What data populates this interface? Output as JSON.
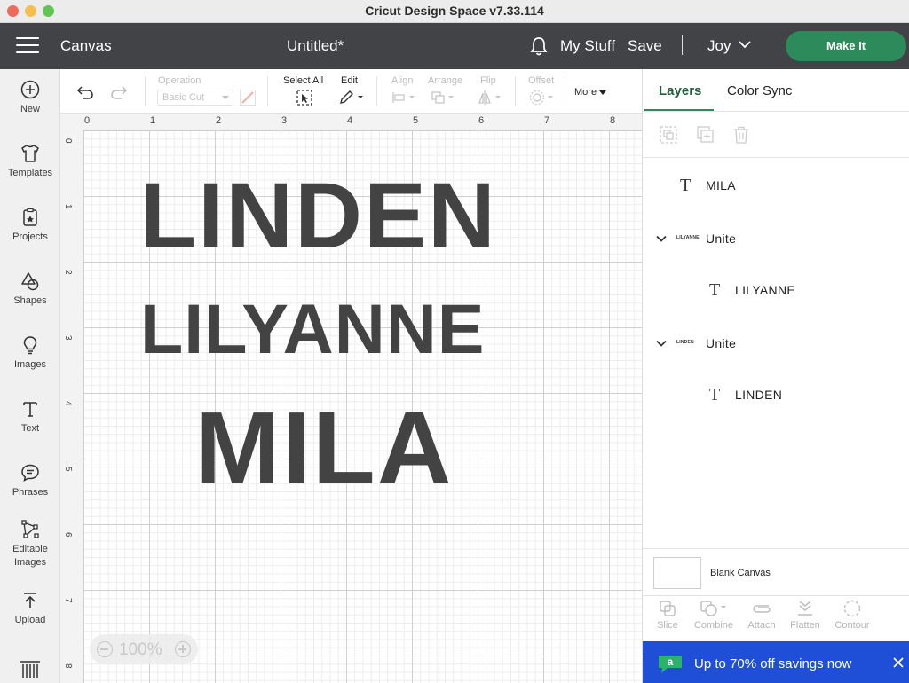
{
  "window": {
    "title": "Cricut Design Space  v7.33.114"
  },
  "header": {
    "section": "Canvas",
    "document": "Untitled*",
    "my_stuff": "My Stuff",
    "save": "Save",
    "separator": "|",
    "user": "Joy",
    "make_it": "Make It"
  },
  "sidebar": {
    "items": [
      {
        "label": "New",
        "icon": "plus-circle-icon"
      },
      {
        "label": "Templates",
        "icon": "shirt-icon"
      },
      {
        "label": "Projects",
        "icon": "projects-icon"
      },
      {
        "label": "Shapes",
        "icon": "shapes-icon"
      },
      {
        "label": "Images",
        "icon": "lightbulb-icon"
      },
      {
        "label": "Text",
        "icon": "text-icon"
      },
      {
        "label": "Phrases",
        "icon": "speech-bubble-icon"
      },
      {
        "label": "Editable",
        "label2": "Images",
        "icon": "editable-images-icon"
      },
      {
        "label": "Upload",
        "icon": "upload-icon"
      }
    ]
  },
  "toolbar": {
    "operation_label": "Operation",
    "operation_value": "Basic Cut",
    "select_all": "Select All",
    "edit": "Edit",
    "align": "Align",
    "arrange": "Arrange",
    "flip": "Flip",
    "offset": "Offset",
    "more": "More"
  },
  "rulers": {
    "top": [
      "0",
      "1",
      "2",
      "3",
      "4",
      "5",
      "6",
      "7",
      "8"
    ],
    "left": [
      "0",
      "1",
      "2",
      "3",
      "4",
      "5",
      "6",
      "7",
      "8"
    ]
  },
  "canvas": {
    "texts": [
      "LINDEN",
      "LILYANNE",
      "MILA"
    ],
    "zoom": "100%"
  },
  "layers_panel": {
    "tabs": [
      "Layers",
      "Color Sync"
    ],
    "layers": [
      {
        "name": "MILA",
        "type": "text"
      },
      {
        "name": "Unite",
        "type": "group",
        "thumb": "LILYANNE"
      },
      {
        "name": "LILYANNE",
        "type": "text"
      },
      {
        "name": "Unite",
        "type": "group",
        "thumb": "LINDEN"
      },
      {
        "name": "LINDEN",
        "type": "text"
      }
    ],
    "blank_canvas": "Blank Canvas",
    "bottom_tools": [
      "Slice",
      "Combine",
      "Attach",
      "Flatten",
      "Contour"
    ]
  },
  "promo": {
    "text": "Up to 70% off savings now",
    "logo": "a"
  },
  "colors": {
    "accent": "#2d8a5a",
    "header": "#414346",
    "promo": "#1f4fd6",
    "design_text": "#434343"
  }
}
